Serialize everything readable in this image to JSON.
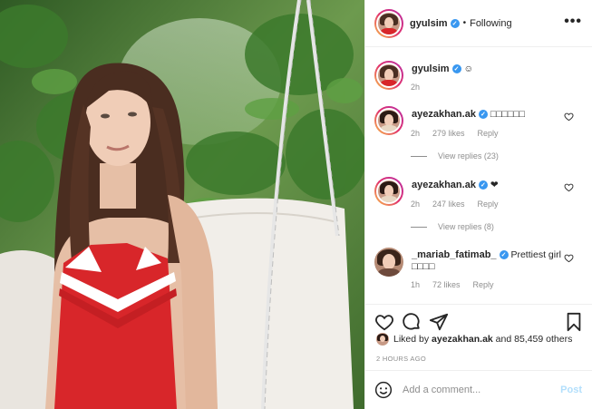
{
  "post_author": {
    "username": "gyulsim",
    "verified_glyph": "✓",
    "separator": "•",
    "follow_state": "Following",
    "more_label": "•••"
  },
  "caption": {
    "username": "gyulsim",
    "text": "☺",
    "time": "2h"
  },
  "comments": [
    {
      "username": "ayezakhan.ak",
      "text": "□□□□□□",
      "time": "2h",
      "likes": "279 likes",
      "reply_label": "Reply",
      "view_replies": "View replies (23)"
    },
    {
      "username": "ayezakhan.ak",
      "text": "❤",
      "time": "2h",
      "likes": "247 likes",
      "reply_label": "Reply",
      "view_replies": "View replies (8)"
    },
    {
      "username": "_mariab_fatimab_",
      "text": "Prettiest girl □□□□",
      "time": "1h",
      "likes": "72 likes",
      "reply_label": "Reply"
    }
  ],
  "liked_by": {
    "prefix": "Liked by",
    "user": "ayezakhan.ak",
    "rest": "and 85,459 others"
  },
  "timestamp": "2 HOURS AGO",
  "composer": {
    "placeholder": "Add a comment...",
    "post_label": "Post"
  },
  "icons": [
    "heart-icon",
    "comment-icon",
    "share-icon",
    "bookmark-icon",
    "emoji-icon",
    "more-icon"
  ],
  "colors": {
    "verified": "#3897f0",
    "muted": "#8e8e8e",
    "post_disabled": "#b2dffc",
    "dress_red": "#d8262a"
  }
}
